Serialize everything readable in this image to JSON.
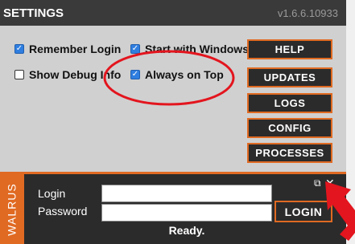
{
  "header": {
    "title": "SETTINGS",
    "version": "v1.6.6.10933"
  },
  "options": {
    "remember_login": {
      "label": "Remember Login",
      "checked": true
    },
    "start_with_windows": {
      "label": "Start with Windows",
      "checked": true
    },
    "show_debug_info": {
      "label": "Show Debug Info",
      "checked": false
    },
    "always_on_top": {
      "label": "Always on Top",
      "checked": true
    }
  },
  "side_buttons": [
    "HELP",
    "UPDATES",
    "LOGS",
    "CONFIG",
    "PROCESSES"
  ],
  "login_panel": {
    "brand": "WALRUS",
    "login_label": "Login",
    "password_label": "Password",
    "login_value": "",
    "password_value": "",
    "login_button": "LOGIN",
    "status": "Ready.",
    "restore_icon": "restore-window-icon",
    "close_icon": "close-icon"
  },
  "colors": {
    "accent": "#e06a22",
    "annotation": "#e3151e",
    "checkbox": "#2f7ee0",
    "dark": "#2b2b2b"
  }
}
